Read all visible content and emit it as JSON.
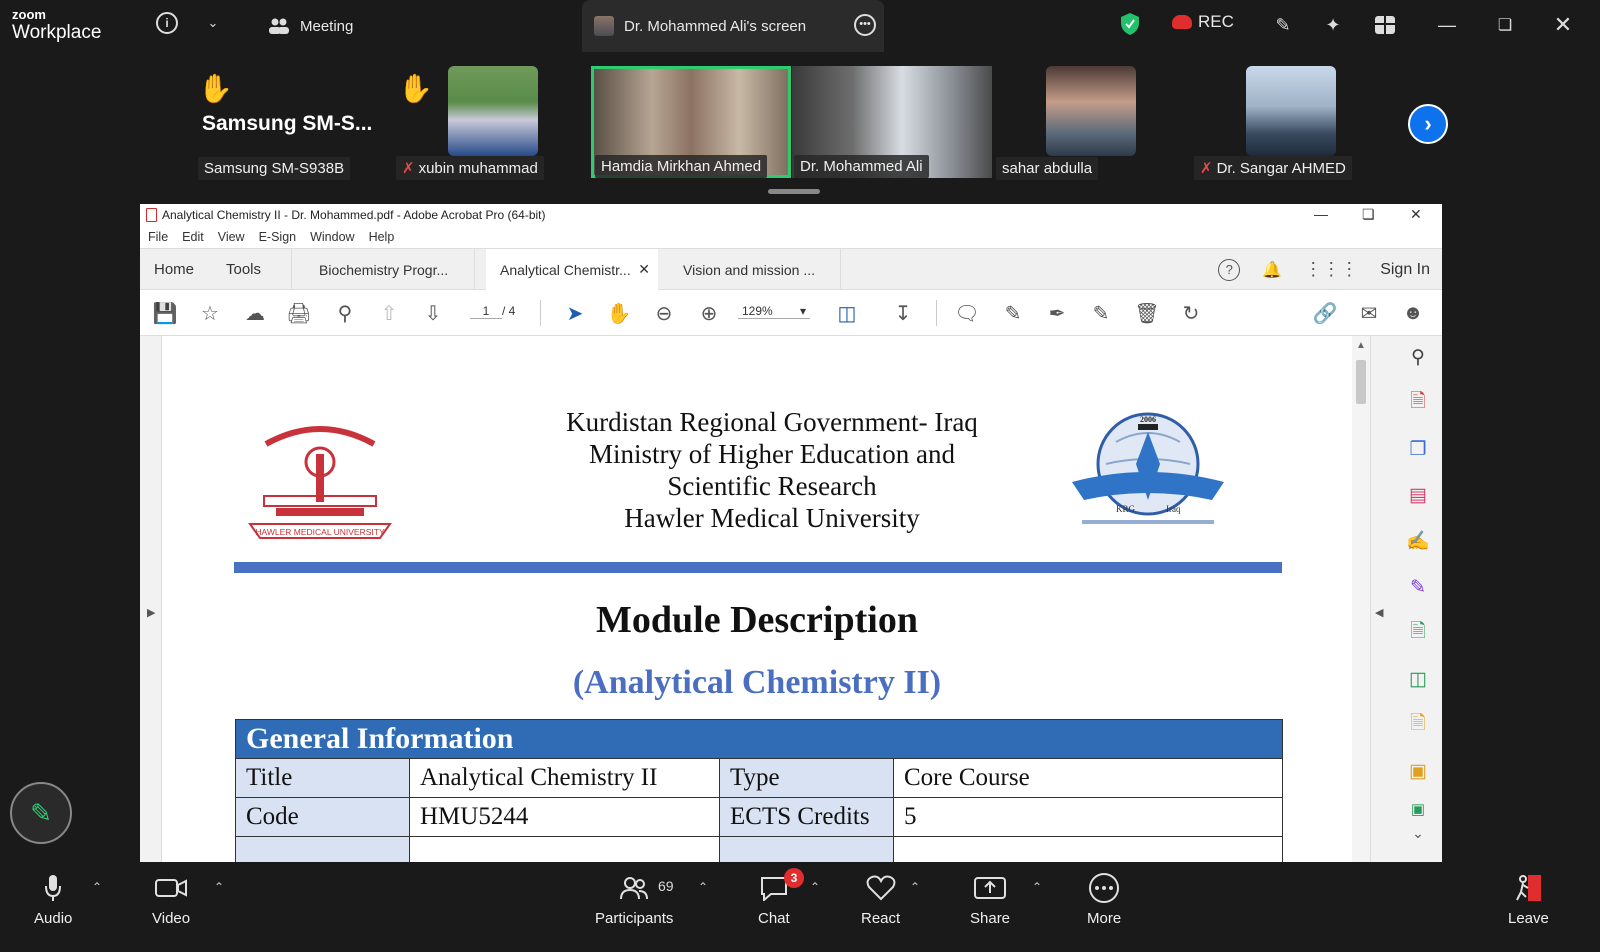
{
  "zoom": {
    "brand_small": "zoom",
    "brand_large": "Workplace",
    "meeting_label": "Meeting",
    "screen_tab_label": "Dr. Mohammed Ali's screen",
    "rec_label": "REC",
    "colors": {
      "accent": "#0e72ed",
      "rec": "#e02d2d",
      "shield": "#23c16b"
    }
  },
  "participants": [
    {
      "name": "Samsung SM-S938B",
      "display": "Samsung  SM-S...",
      "hand_raised": true,
      "muted": false
    },
    {
      "name": "xubin muhammad",
      "hand_raised": true,
      "muted": true
    },
    {
      "name": "Hamdia Mirkhan Ahmed",
      "active_speaker": true,
      "muted": false
    },
    {
      "name": "Dr. Mohammed Ali",
      "muted": false
    },
    {
      "name": "sahar abdulla",
      "muted": false
    },
    {
      "name": "Dr. Sangar AHMED",
      "muted": true
    }
  ],
  "acrobat": {
    "title": "Analytical Chemistry II - Dr. Mohammed.pdf - Adobe Acrobat Pro (64-bit)",
    "menu": [
      "File",
      "Edit",
      "View",
      "E-Sign",
      "Window",
      "Help"
    ],
    "nav": [
      "Home",
      "Tools"
    ],
    "tabs": [
      "Biochemistry Progr...",
      "Analytical Chemistr...",
      "Vision and mission ..."
    ],
    "active_tab": 1,
    "sign_in": "Sign In",
    "page_current": "1",
    "page_total": "/  4",
    "zoom": "129%"
  },
  "document": {
    "header_lines": [
      "Kurdistan Regional Government- Iraq",
      "Ministry of Higher Education and",
      "Scientific Research",
      "Hawler Medical University"
    ],
    "logo_left_text": "HAWLER MEDICAL UNIVERSITY",
    "logo_right_year": "2006",
    "logo_right_left": "KRG",
    "logo_right_right": "Iraq",
    "module_title": "Module Description",
    "module_subtitle": "(Analytical Chemistry II)",
    "general_info_heading": "General Information",
    "rows": [
      [
        "Title",
        "Analytical Chemistry II",
        "Type",
        "Core Course"
      ],
      [
        "Code",
        "HMU5244",
        "ECTS Credits",
        "5"
      ]
    ]
  },
  "controls": {
    "audio": "Audio",
    "video": "Video",
    "participants": "Participants",
    "participants_count": "69",
    "chat": "Chat",
    "chat_badge": "3",
    "react": "React",
    "share": "Share",
    "more": "More",
    "leave": "Leave"
  }
}
